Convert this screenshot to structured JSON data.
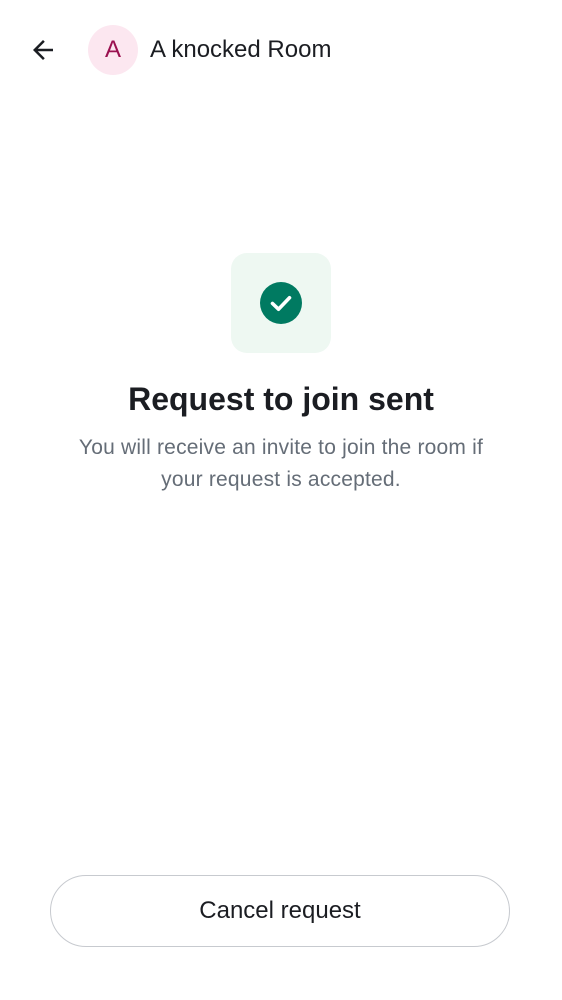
{
  "header": {
    "back_icon": "arrow-left-icon",
    "avatar_initial": "A",
    "room_name": "A knocked Room"
  },
  "status": {
    "icon": "check-circle-icon",
    "title": "Request to join sent",
    "description": "You will receive an invite to join the room if your request is accepted."
  },
  "actions": {
    "cancel_label": "Cancel request"
  },
  "colors": {
    "accent_green": "#007a61",
    "avatar_bg": "#fce7f0",
    "avatar_text": "#9b1150",
    "tile_bg": "#eef8f2"
  }
}
